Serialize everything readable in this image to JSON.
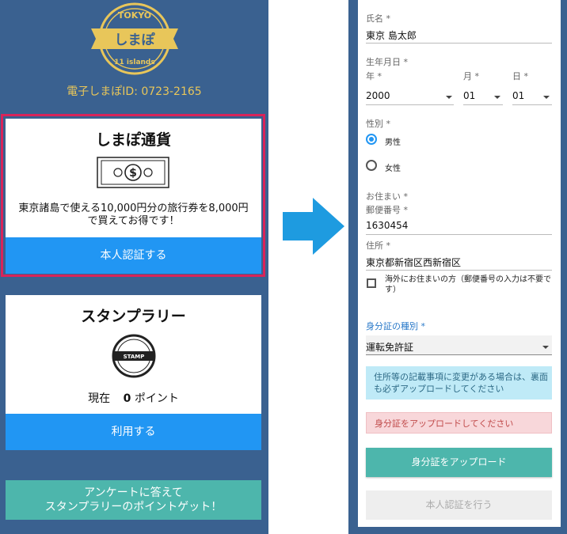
{
  "left": {
    "logo": {
      "top_text": "TOKYO",
      "main_text": "しまぽ",
      "bottom_text": "11 islands"
    },
    "shimapo_id": "電子しまぽID: 0723-2165",
    "currency_card": {
      "title": "しまぽ通貨",
      "description_line1": "東京諸島で使える10,000円分の旅行券を8,000円",
      "description_line2": "で買えてお得です！",
      "button": "本人認証する"
    },
    "stamp_card": {
      "title": "スタンプラリー",
      "stamp_text": "STAMP",
      "points_prefix": "現在",
      "points_value": "0",
      "points_unit": "ポイント",
      "button": "利用する"
    },
    "survey_button": {
      "line1": "アンケートに答えて",
      "line2": "スタンプラリーのポイントゲット！"
    }
  },
  "form": {
    "name": {
      "label": "氏名 *",
      "value": "東京 島太郎"
    },
    "birthdate": {
      "label": "生年月日 *",
      "year_label": "年 *",
      "year_value": "2000",
      "month_label": "月 *",
      "month_value": "01",
      "day_label": "日 *",
      "day_value": "01"
    },
    "gender": {
      "label": "性別 *",
      "male": "男性",
      "female": "女性",
      "selected": "male"
    },
    "address": {
      "label": "お住まい *",
      "postal_label": "郵便番号 *",
      "postal_value": "1630454",
      "address_label": "住所 *",
      "address_value": "東京都新宿区西新宿区",
      "overseas_line1": "海外にお住まいの方（郵便番号の入力は不要で",
      "overseas_line2": "す）"
    },
    "id_type": {
      "label": "身分証の種別 *",
      "value": "運転免許証"
    },
    "info_line1": "住所等の記載事項に変更がある場合は、裏面",
    "info_line2": "も必ずアップロードしてください",
    "error": "身分証をアップロードしてください",
    "upload_button": "身分証をアップロード",
    "verify_button": "本人認証を行う"
  },
  "colors": {
    "background_blue": "#3a6190",
    "gold": "#e8c65a",
    "primary_blue": "#2196f3",
    "teal": "#4db6ac",
    "highlight_border": "#d8245a",
    "arrow": "#1e9be0"
  }
}
